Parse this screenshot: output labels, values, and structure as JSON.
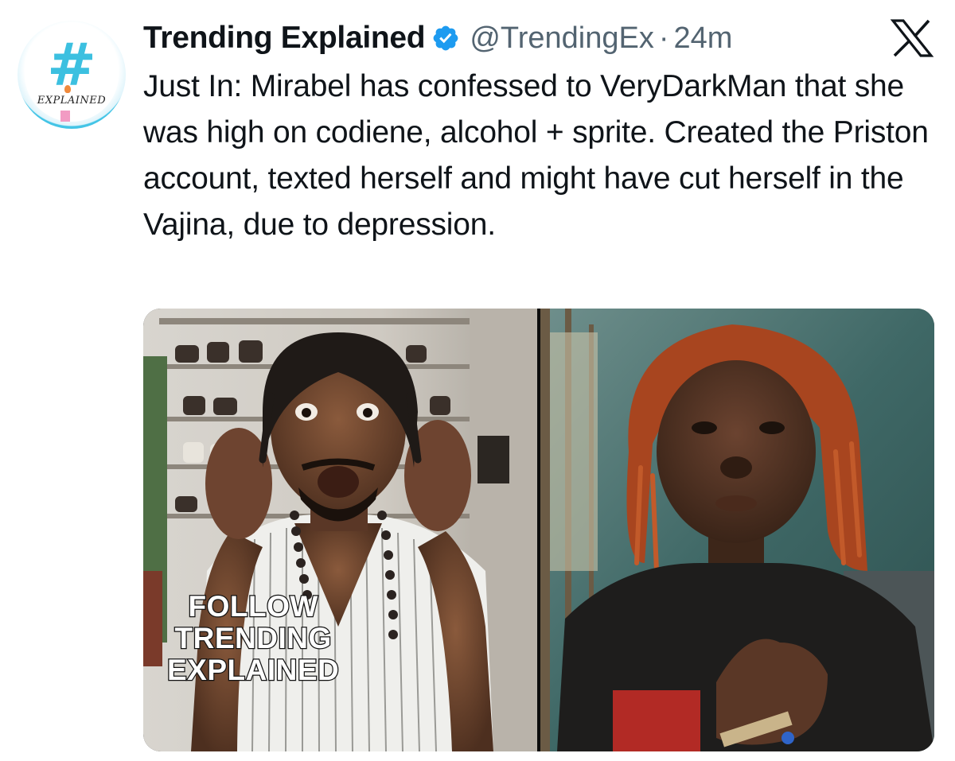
{
  "author": {
    "display_name": "Trending Explained",
    "handle": "@TrendingEx",
    "separator": "·",
    "time": "24m",
    "verified": true,
    "avatar": {
      "symbol": "#",
      "word": "EXPLAINED",
      "colors": {
        "ring": "#43c4e6",
        "symbol": "#3cc0e0"
      }
    }
  },
  "platform": {
    "icon": "x-logo"
  },
  "tweet": {
    "text": "Just In: Mirabel has confessed to VeryDarkMan that she was high on codiene, alcohol + sprite. Created the Priston account, texted herself and might have cut herself in the Vajina, due to depression."
  },
  "media": {
    "caption_lines": [
      "FOLLOW",
      "TRENDING",
      "EXPLAINED"
    ]
  },
  "colors": {
    "verified_badge": "#1d9bf0",
    "secondary_text": "#536471"
  }
}
